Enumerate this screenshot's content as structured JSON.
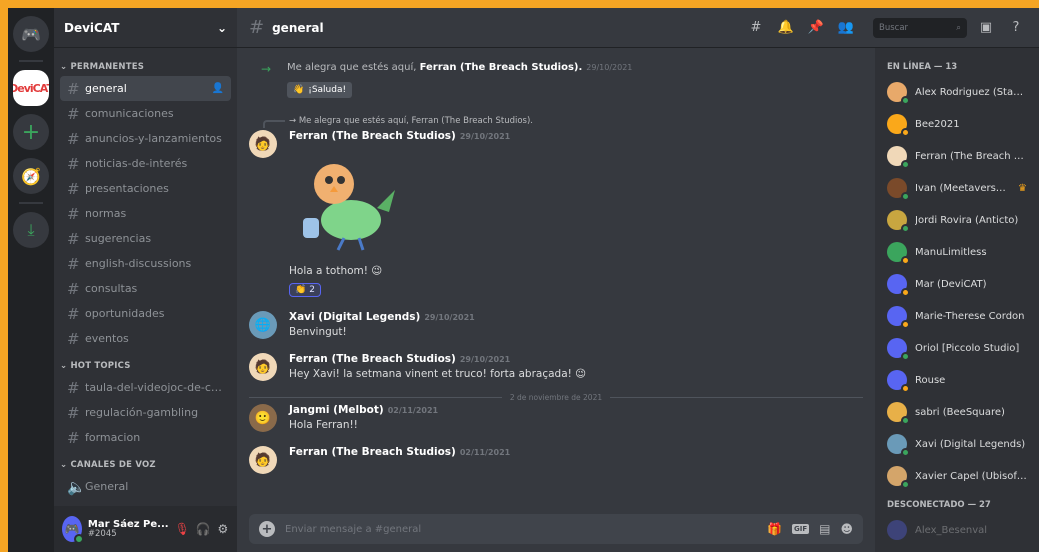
{
  "server": {
    "name": "DeviCAT",
    "logo_text": "DeviCAT"
  },
  "categories": {
    "permanentes": "PERMANENTES",
    "hot_topics": "HOT TOPICS",
    "voz": "CANALES DE VOZ"
  },
  "channels_permanentes": [
    "general",
    "comunicaciones",
    "anuncios-y-lanzamientos",
    "noticias-de-interés",
    "presentaciones",
    "normas",
    "sugerencias",
    "english-discussions",
    "consultas",
    "oportunidades",
    "eventos"
  ],
  "channels_hot": [
    "taula-del-videojoc-de-cat...",
    "regulación-gambling",
    "formacion"
  ],
  "voice_channel": "General",
  "user": {
    "name": "Mar Sáez Pe...",
    "tag": "#2045"
  },
  "topbar": {
    "channel": "general",
    "search_placeholder": "Buscar"
  },
  "messages": {
    "system_text": "Me alegra que estés aquí, ",
    "system_user": "Ferran (The Breach Studios).",
    "system_time": "29/10/2021",
    "wave_label": "¡Saluda!",
    "reply_text": "→ Me alegra que estés aquí, Ferran (The Breach Studios).",
    "m1_author": "Ferran (The Breach Studios)",
    "m1_time": "29/10/2021",
    "m1_text": "Hola a tothom! 😉",
    "m1_reaction": "2",
    "m2_author": "Xavi (Digital Legends)",
    "m2_time": "29/10/2021",
    "m2_text": "Benvingut!",
    "m3_author": "Ferran (The Breach Studios)",
    "m3_time": "29/10/2021",
    "m3_text": "Hey Xavi! la setmana vinent et truco! forta abraçada! 😉",
    "day_sep": "2 de noviembre de 2021",
    "m4_author": "Jangmi (Melbot)",
    "m4_time": "02/11/2021",
    "m4_text": "Hola Ferran!!",
    "m5_author": "Ferran (The Breach Studios)",
    "m5_time": "02/11/2021"
  },
  "composer": {
    "placeholder": "Enviar mensaje a #general",
    "gif": "GIF"
  },
  "members": {
    "online_header": "EN LÍNEA — 13",
    "offline_header": "DESCONECTADO — 27",
    "online": [
      {
        "name": "Alex Rodriguez (Starlo...",
        "color": "#e8a96a",
        "status": "online"
      },
      {
        "name": "Bee2021",
        "color": "#faa81a",
        "status": "idle"
      },
      {
        "name": "Ferran (The Breach St...",
        "color": "#f0d8b8",
        "status": "online"
      },
      {
        "name": "Ivan (Meetaverse-...",
        "color": "#7a4a2a",
        "status": "online"
      },
      {
        "name": "Jordi Rovira (Anticto)",
        "color": "#c8a640",
        "status": "online"
      },
      {
        "name": "ManuLimitless",
        "color": "#3ba55d",
        "status": "idle"
      },
      {
        "name": "Mar (DeviCAT)",
        "color": "#5865f2",
        "status": "idle"
      },
      {
        "name": "Marie-Therese Cordon",
        "color": "#5865f2",
        "status": "idle"
      },
      {
        "name": "Oriol [Piccolo Studio]",
        "color": "#5865f2",
        "status": "online"
      },
      {
        "name": "Rouse",
        "color": "#5865f2",
        "status": "idle"
      },
      {
        "name": "sabri (BeeSquare)",
        "color": "#e8b048",
        "status": "online"
      },
      {
        "name": "Xavi (Digital Legends)",
        "color": "#6a9ab8",
        "status": "online"
      },
      {
        "name": "Xavier Capel (Ubisoft ...",
        "color": "#d4a56a",
        "status": "online"
      }
    ],
    "offline": [
      {
        "name": "Alex_Besenval",
        "color": "#5865f2"
      }
    ]
  }
}
